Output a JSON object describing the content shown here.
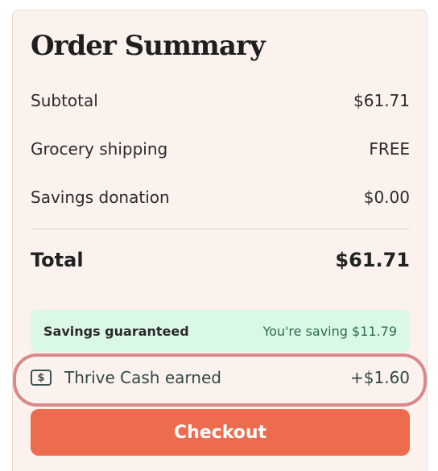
{
  "summary": {
    "title": "Order Summary",
    "rows": [
      {
        "label": "Subtotal",
        "value": "$61.71"
      },
      {
        "label": "Grocery shipping",
        "value": "FREE"
      },
      {
        "label": "Savings donation",
        "value": "$0.00"
      }
    ],
    "total": {
      "label": "Total",
      "value": "$61.71"
    },
    "savings": {
      "label": "Savings guaranteed",
      "value": "You're saving $11.79"
    },
    "thrive_cash": {
      "label": "Thrive Cash earned",
      "value": "+$1.60",
      "icon": "dollar-bill-icon"
    },
    "checkout_label": "Checkout"
  },
  "colors": {
    "panel_bg": "#fbf1ed",
    "savings_bg": "#d9f9e6",
    "highlight": "#d9898a",
    "checkout": "#ed6c50"
  }
}
